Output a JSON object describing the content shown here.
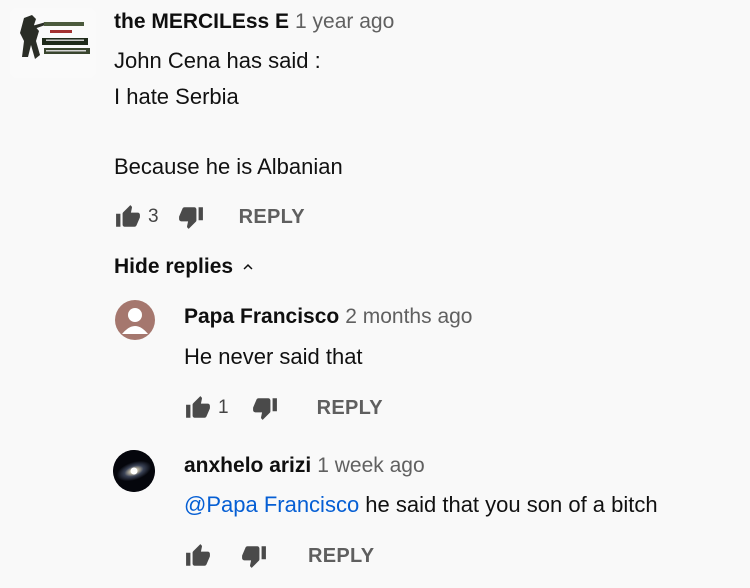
{
  "comment": {
    "author": "the MERCILEss E",
    "time": "1 year ago",
    "lines": [
      "John Cena has said :",
      "I hate Serbia",
      "",
      "Because he is Albanian"
    ],
    "likes": "3",
    "reply_label": "REPLY",
    "avatar_icon": "soldier-logo-avatar"
  },
  "hide_replies_label": "Hide replies",
  "replies": [
    {
      "author": "Papa Francisco",
      "time": "2 months ago",
      "text": "He never said that",
      "likes": "1",
      "reply_label": "REPLY",
      "avatar_icon": "default-user-avatar"
    },
    {
      "author": "anxhelo arizi",
      "time": "1 week ago",
      "mention": "@Papa Francisco",
      "text": " he said that you son of a bitch",
      "likes": "",
      "reply_label": "REPLY",
      "avatar_icon": "galaxy-avatar"
    }
  ],
  "colors": {
    "background": "#f9f9f9",
    "mention": "#065fd4",
    "icon": "#4a4a4a",
    "meta": "#606060"
  }
}
